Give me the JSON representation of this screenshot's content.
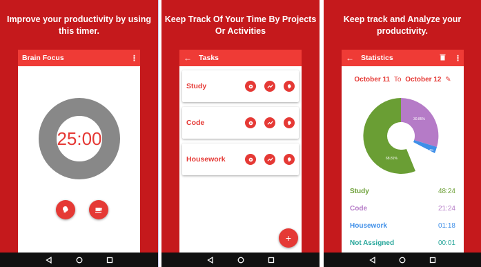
{
  "colors": {
    "background": "#c5191c",
    "appbar": "#ef3b36",
    "accent": "#e53935",
    "ring": "#888888",
    "navbar": "#111111",
    "study": "#6a9e34",
    "code": "#b57bc7",
    "housework": "#3f8fe8",
    "not_assigned": "#26a69a"
  },
  "panel1": {
    "caption": "Improve your productivity by using this timer.",
    "appbar_title": "Brain Focus",
    "menu_icon": "more-vert-icon",
    "timer": "25:00",
    "buttons": [
      {
        "icon": "brain-icon"
      },
      {
        "icon": "coffee-cup-icon"
      }
    ]
  },
  "panel2": {
    "caption": "Keep Track Of Your Time By Projects Or Activities",
    "appbar_title": "Tasks",
    "tasks": [
      {
        "name": "Study"
      },
      {
        "name": "Code"
      },
      {
        "name": "Housework"
      }
    ],
    "task_action_icons": [
      "settings-icon",
      "trend-icon",
      "brain-icon"
    ],
    "fab_label": "+"
  },
  "panel3": {
    "caption": "Keep track and Analyze your productivity.",
    "appbar_title": "Statistics",
    "date_from": "October 11",
    "date_to_word": "To",
    "date_to": "October 12",
    "pie_labels": {
      "study": "68.81%",
      "code": "30.85%",
      "housework": "1.4%"
    },
    "rows": [
      {
        "name": "Study",
        "value": "48:24",
        "color_key": "study"
      },
      {
        "name": "Code",
        "value": "21:24",
        "color_key": "code"
      },
      {
        "name": "Housework",
        "value": "01:18",
        "color_key": "housework"
      },
      {
        "name": "Not Assigned",
        "value": "00:01",
        "color_key": "not_assigned"
      }
    ]
  }
}
